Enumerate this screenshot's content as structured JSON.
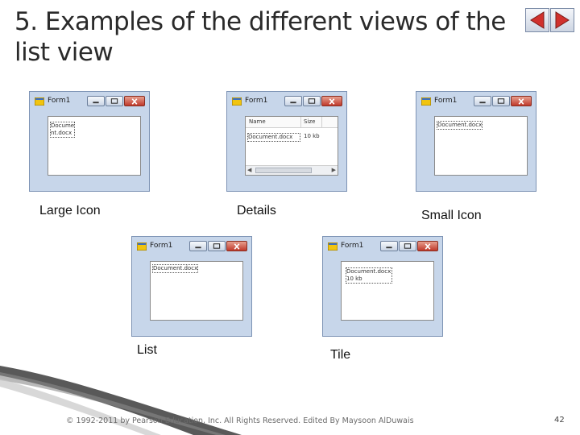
{
  "slide": {
    "title_line1": "5. Examples of the different views of the",
    "title_line2": "list view",
    "footer": "© 1992-2011 by Pearson Education, Inc. All Rights Reserved. Edited By Maysoon AlDuwais",
    "page_number": "42"
  },
  "windows": [
    {
      "id": "large-icon",
      "title": "Form1",
      "item_line1": "Docume",
      "item_line2": "nt.docx",
      "caption": "Large Icon"
    },
    {
      "id": "details",
      "title": "Form1",
      "col_name": "Name",
      "col_size": "Size",
      "item_name": "Document.docx",
      "item_size": "10 kb",
      "caption": "Details"
    },
    {
      "id": "small-icon",
      "title": "Form1",
      "item": "Document.docx",
      "caption": "Small Icon"
    },
    {
      "id": "list",
      "title": "Form1",
      "item": "Document.docx",
      "caption": "List"
    },
    {
      "id": "tile",
      "title": "Form1",
      "item_line1": "Document.docx",
      "item_line2": "10 kb",
      "caption": "Tile"
    }
  ],
  "colors": {
    "title_text": "#2a2a2a",
    "window_frame": "#c7d6ea",
    "close_button": "#c0392b",
    "nav_arrow": "#d0312d"
  },
  "icons": {
    "prev": "left-arrow-icon",
    "next": "right-arrow-icon",
    "app": "form-app-icon",
    "minimize": "minimize-icon",
    "maximize": "maximize-icon",
    "close": "close-icon"
  }
}
